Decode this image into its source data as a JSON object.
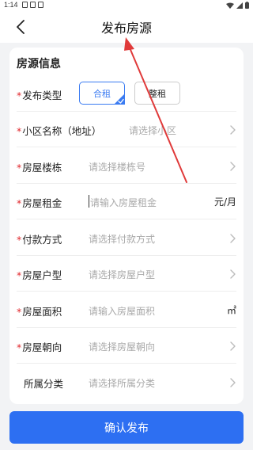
{
  "status_bar": {
    "time": "1:14"
  },
  "nav": {
    "title": "发布房源"
  },
  "section": {
    "title": "房源信息"
  },
  "publish_type": {
    "label": "发布类型",
    "options": [
      {
        "label": "合租",
        "selected": true
      },
      {
        "label": "整租",
        "selected": false
      }
    ]
  },
  "fields": [
    {
      "label": "小区名称（地址）",
      "required": true,
      "placeholder": "请选择小区",
      "kind": "select"
    },
    {
      "label": "房屋楼栋",
      "required": true,
      "placeholder": "请选择楼栋号",
      "kind": "select"
    },
    {
      "label": "房屋租金",
      "required": true,
      "placeholder": "请输入房屋租金",
      "kind": "input",
      "unit": "元/月"
    },
    {
      "label": "付款方式",
      "required": true,
      "placeholder": "请选择付款方式",
      "kind": "select"
    },
    {
      "label": "房屋户型",
      "required": true,
      "placeholder": "请选择房屋户型",
      "kind": "select"
    },
    {
      "label": "房屋面积",
      "required": true,
      "placeholder": "请输入房屋面积",
      "kind": "input",
      "unit": "㎡"
    },
    {
      "label": "房屋朝向",
      "required": true,
      "placeholder": "请选择房屋朝向",
      "kind": "select"
    },
    {
      "label": "所属分类",
      "required": false,
      "placeholder": "请选择所属分类",
      "kind": "select"
    }
  ],
  "required_mark": "*",
  "confirm_button": {
    "label": "确认发布"
  },
  "colors": {
    "accent": "#2d6ff2",
    "required": "#e0262b",
    "annotation_arrow": "#e03a3a"
  }
}
